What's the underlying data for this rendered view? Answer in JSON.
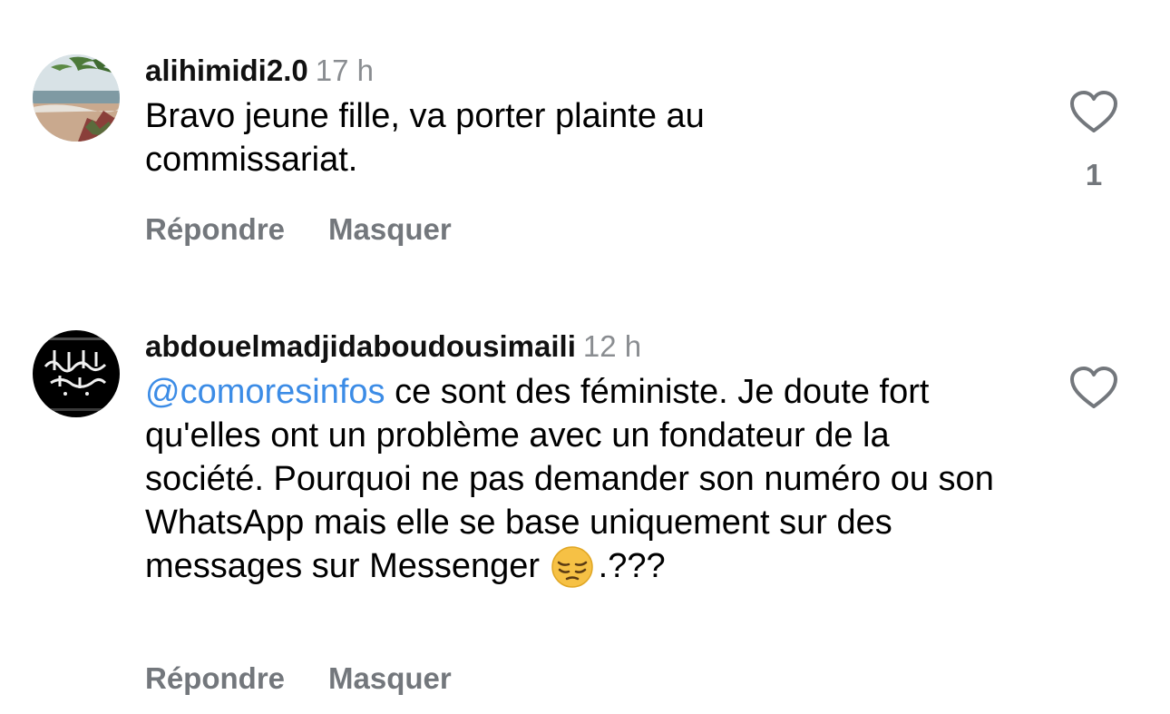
{
  "comments": [
    {
      "username": "alihimidi2.0",
      "time": "17 h",
      "text": "Bravo jeune fille, va porter plainte au commissariat.",
      "reply_label": "Répondre",
      "hide_label": "Masquer",
      "like_count": "1"
    },
    {
      "username": "abdouelmadjidaboudousimaili",
      "time": "12 h",
      "mention": "@comoresinfos",
      "text": " ce sont des féministe. Je doute fort qu'elles ont un problème avec un fondateur de la société. Pourquoi ne pas demander son numéro ou son WhatsApp mais elle se base uniquement sur des messages sur Messenger ",
      "emoji": "pensive-face",
      "text_end": ".???",
      "reply_label": "Répondre",
      "hide_label": "Masquer"
    }
  ],
  "colors": {
    "mention": "#3c8ce6",
    "secondary_text": "#73777c",
    "timestamp": "#8a8d91"
  }
}
